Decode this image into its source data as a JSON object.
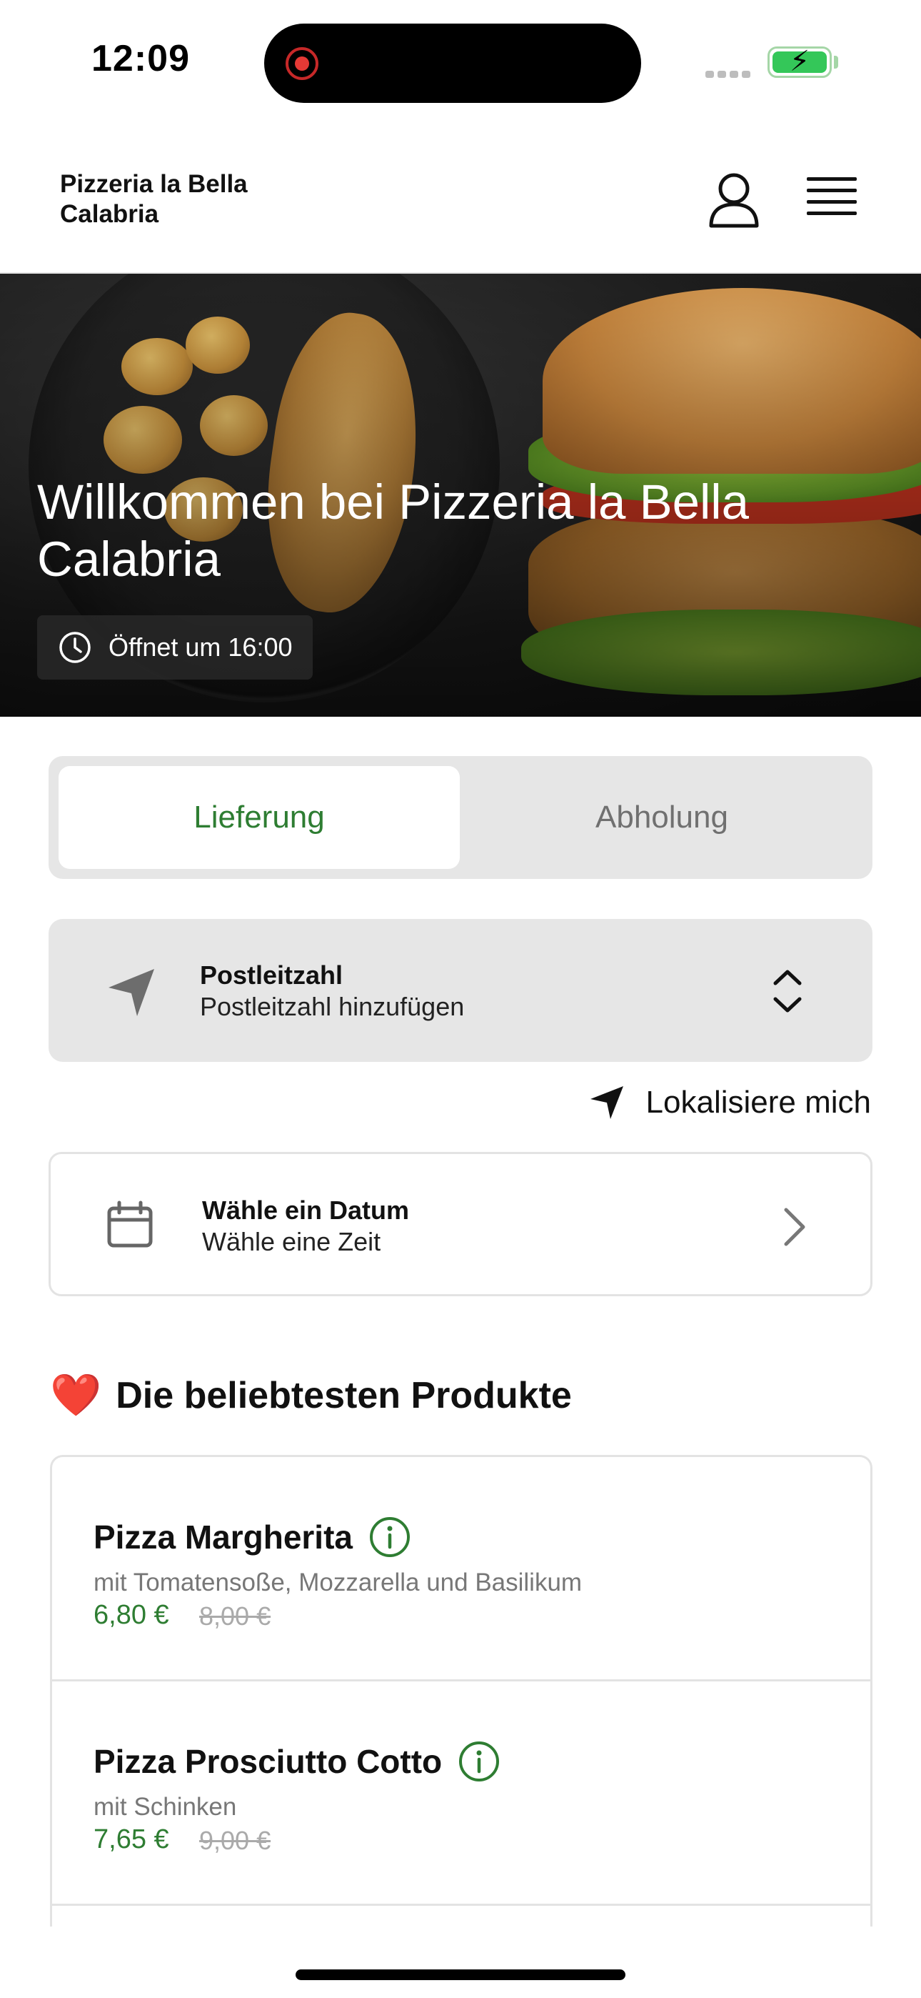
{
  "status_bar": {
    "time": "12:09"
  },
  "header": {
    "brand_line1": "Pizzeria la Bella",
    "brand_line2": "Calabria"
  },
  "hero": {
    "title": "Willkommen bei Pizzeria la Bella Calabria",
    "opening_info": "Öffnet um 16:00"
  },
  "order_mode": {
    "tabs": [
      {
        "label": "Lieferung",
        "selected": true
      },
      {
        "label": "Abholung",
        "selected": false
      }
    ]
  },
  "postcode": {
    "label": "Postleitzahl",
    "placeholder": "Postleitzahl hinzufügen"
  },
  "locate": {
    "label": "Lokalisiere mich"
  },
  "schedule": {
    "label": "Wähle ein Datum",
    "sublabel": "Wähle eine Zeit"
  },
  "popular": {
    "emoji": "❤️",
    "title": "Die beliebtesten Produkte",
    "items": [
      {
        "name": "Pizza Margherita",
        "description": "mit Tomatensoße, Mozzarella und Basilikum",
        "price": "6,80 €",
        "old_price": "8,00 €"
      },
      {
        "name": "Pizza Prosciutto Cotto",
        "description": "mit Schinken",
        "price": "7,65 €",
        "old_price": "9,00 €"
      }
    ]
  },
  "colors": {
    "accent_green": "#2e7d32",
    "muted_bg": "#e6e6e6",
    "heart_red": "#e53935"
  },
  "icons": [
    "record-icon",
    "battery-icon",
    "user-icon",
    "menu-icon",
    "clock-icon",
    "navigation-icon",
    "updown-chevron-icon",
    "location-arrow-icon",
    "calendar-icon",
    "chevron-right-icon",
    "info-icon"
  ]
}
